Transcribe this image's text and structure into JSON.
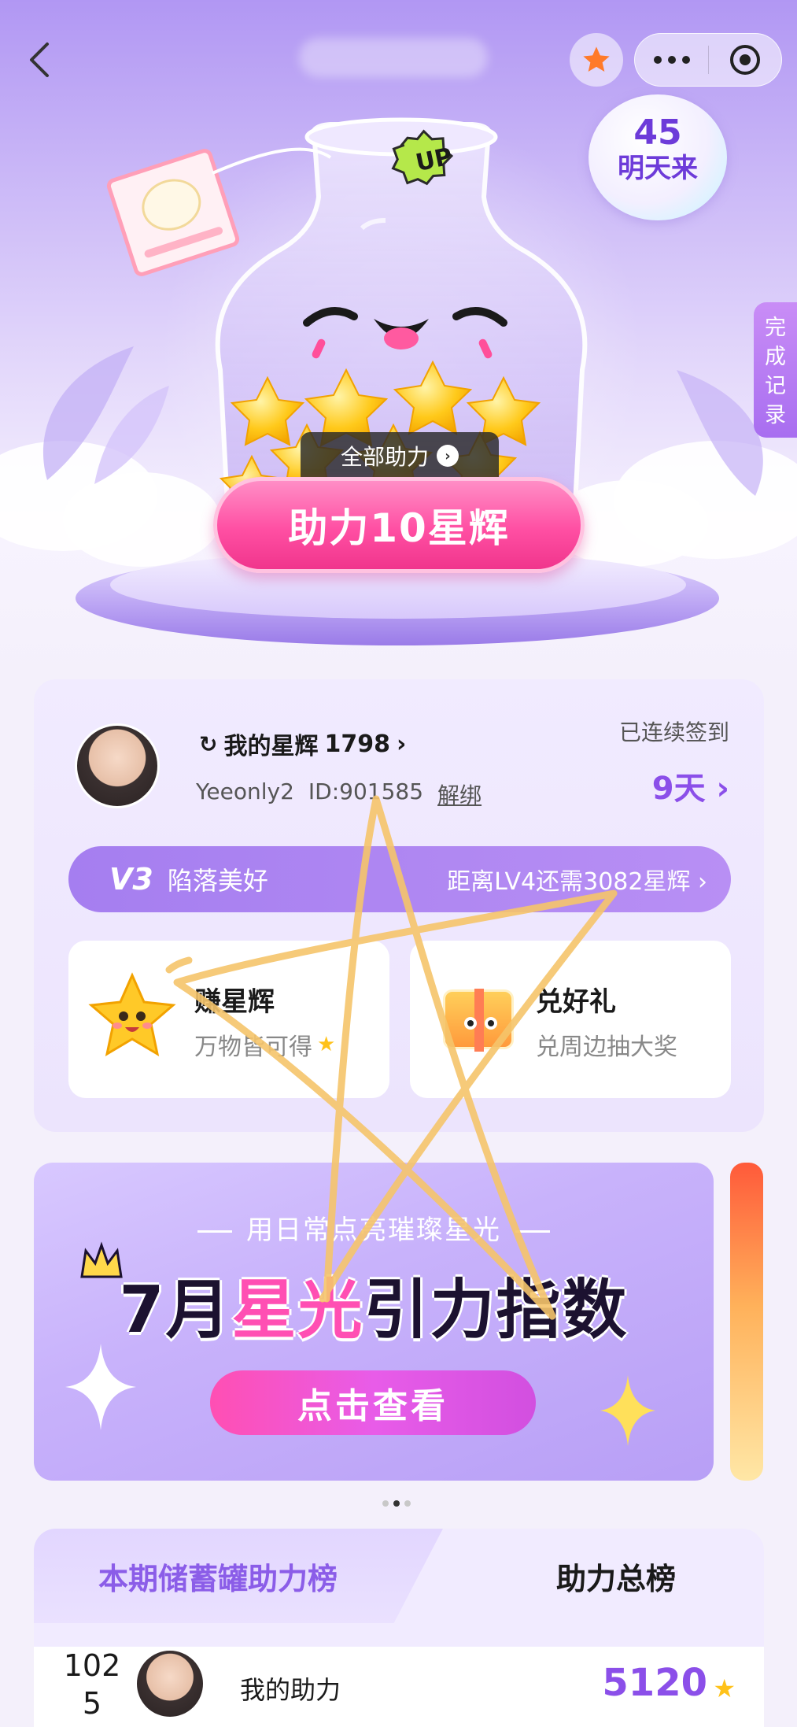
{
  "topbar": {
    "back_icon": "chevron-left-icon",
    "favorite_icon": "star-icon",
    "more_icon": "more-dots-icon",
    "close_icon": "target-close-icon"
  },
  "countdown": {
    "number": "45",
    "text": "明天来"
  },
  "record_tab": {
    "chars": [
      "完",
      "成",
      "记",
      "录"
    ]
  },
  "jar": {
    "badge": "UP"
  },
  "hero": {
    "all_help_label": "全部助力",
    "help_button_label": "助力10星辉"
  },
  "user": {
    "stars_label": "我的星辉",
    "stars_value": "1798",
    "name": "Yeeonly2",
    "id": "ID:901585",
    "unbind_label": "解绑",
    "signin_label": "已连续签到",
    "signin_days": "9天"
  },
  "level": {
    "badge": "V3",
    "name": "陷落美好",
    "progress_text": "距离LV4还需3082星辉"
  },
  "tiles": {
    "earn": {
      "title": "赚星辉",
      "subtitle": "万物皆可得"
    },
    "redeem": {
      "title": "兑好礼",
      "subtitle": "兑周边抽大奖"
    }
  },
  "banner": {
    "subtitle": "用日常点亮璀璨星光",
    "title_prefix": "7月",
    "title_highlight": "星光",
    "title_suffix": "引力指数",
    "button_label": "点击查看"
  },
  "carousel": {
    "active_index": 1,
    "count": 3
  },
  "rank": {
    "tab_active": "本期储蓄罐助力榜",
    "tab_total": "助力总榜",
    "my_rank_line1": "102",
    "my_rank_line2": "5",
    "my_label": "我的助力",
    "my_score": "5120"
  },
  "colors": {
    "accent_purple": "#8b4fe9",
    "pink_button": "#ff4fa3",
    "star_yellow": "#ffc21a",
    "doodle_stroke": "#f5c46a"
  }
}
